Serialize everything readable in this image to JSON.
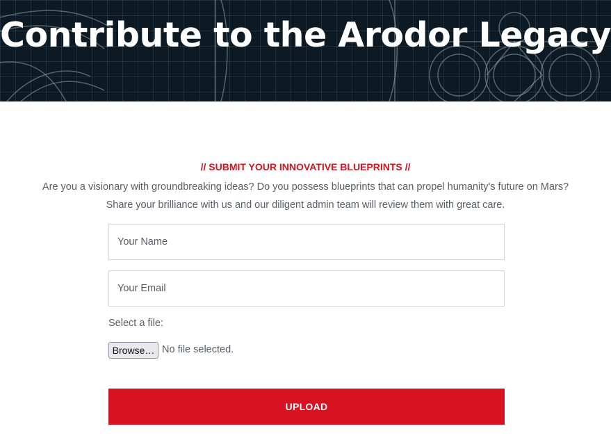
{
  "hero": {
    "title": "Contribute to the Arodor Legacy"
  },
  "submission": {
    "section_label": "// SUBMIT YOUR INNOVATIVE BLUEPRINTS //",
    "intro_line_1": "Are you a visionary with groundbreaking ideas? Do you possess blueprints that can propel humanity's future on Mars?",
    "intro_line_2": "Share your brilliance with us and our diligent admin team will review them with great care."
  },
  "form": {
    "name_placeholder": "Your Name",
    "email_placeholder": "Your Email",
    "file_label": "Select a file:",
    "browse_label": "Browse…",
    "file_status": "No file selected.",
    "upload_label": "UPLOAD"
  },
  "colors": {
    "accent": "#d81221",
    "hero_background": "#0d1a24",
    "body_text": "#555d66"
  },
  "icons": {
    "hero_decoration": "blueprint-schematic-graphic"
  }
}
